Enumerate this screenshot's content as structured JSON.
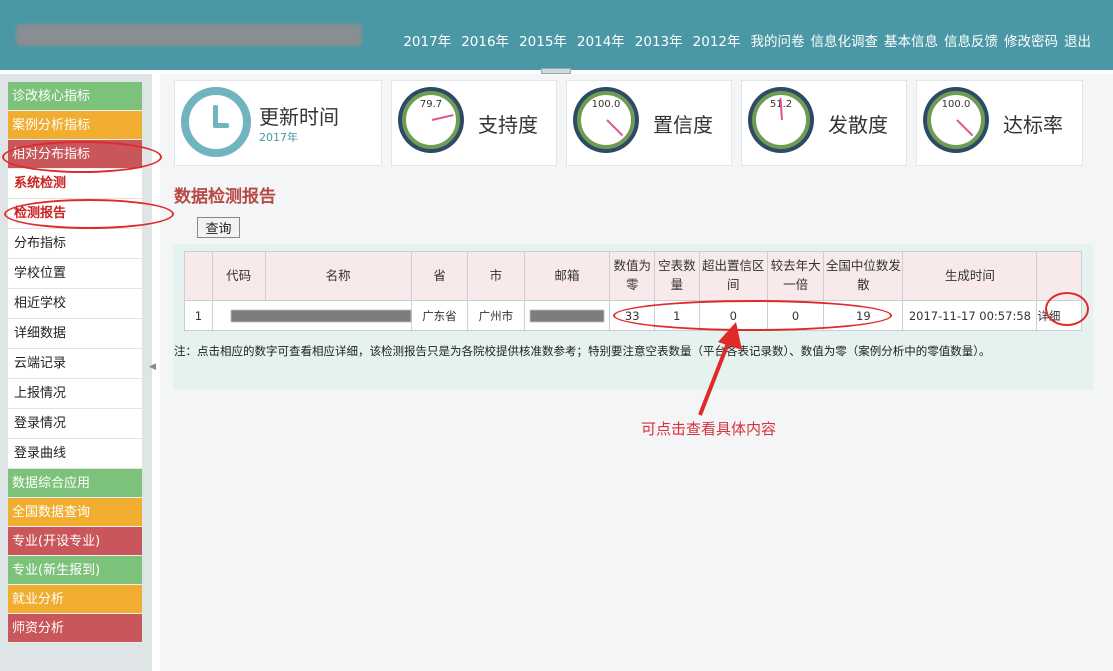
{
  "header": {
    "nav": [
      "2017年",
      "2016年",
      "2015年",
      "2014年",
      "2013年",
      "2012年",
      "我的问卷",
      "信息化调查",
      "基本信息",
      "信息反馈",
      "修改密码",
      "退出"
    ]
  },
  "sidebar": {
    "items": [
      {
        "label": "诊改核心指标",
        "style": "green"
      },
      {
        "label": "案例分析指标",
        "style": "orange"
      },
      {
        "label": "相对分布指标",
        "style": "red"
      },
      {
        "label": "系统检测",
        "style": "sub-hl"
      },
      {
        "label": "检测报告",
        "style": "sub-hl"
      },
      {
        "label": "分布指标",
        "style": "sub"
      },
      {
        "label": "学校位置",
        "style": "sub"
      },
      {
        "label": "相近学校",
        "style": "sub"
      },
      {
        "label": "详细数据",
        "style": "sub"
      },
      {
        "label": "云端记录",
        "style": "sub"
      },
      {
        "label": "上报情况",
        "style": "sub"
      },
      {
        "label": "登录情况",
        "style": "sub"
      },
      {
        "label": "登录曲线",
        "style": "sub"
      },
      {
        "label": "数据综合应用",
        "style": "green"
      },
      {
        "label": "全国数据查询",
        "style": "orange"
      },
      {
        "label": "专业(开设专业)",
        "style": "red"
      },
      {
        "label": "专业(新生报到)",
        "style": "green"
      },
      {
        "label": "就业分析",
        "style": "orange"
      },
      {
        "label": "师资分析",
        "style": "red"
      }
    ]
  },
  "cards": {
    "update": {
      "title": "更新时间",
      "sub": "2017年"
    },
    "support": {
      "title": "支持度",
      "value": "79.7"
    },
    "confidence": {
      "title": "置信度",
      "value": "100.0"
    },
    "dispersion": {
      "title": "发散度",
      "value": "51.2"
    },
    "compliance": {
      "title": "达标率",
      "value": "100.0"
    }
  },
  "report": {
    "title": "数据检测报告",
    "query_label": "查询",
    "headers": [
      "",
      "代码",
      "名称",
      "省",
      "市",
      "邮箱",
      "数值为零",
      "空表数量",
      "超出置信区间",
      "较去年大一倍",
      "全国中位数发散",
      "生成时间",
      ""
    ],
    "row": {
      "index": "1",
      "province": "广东省",
      "city": "广州市",
      "zero": "33",
      "empty": "1",
      "out_ci": "0",
      "double": "0",
      "median_div": "19",
      "time": "2017-11-17 00:57:58",
      "detail": "详细"
    },
    "note": "注：点击相应的数字可查看相应详细，该检测报告只是为各院校提供核准数参考；特别要注意空表数量（平台各表记录数）、数值为零（案例分析中的零值数量）。"
  },
  "annotation": {
    "text": "可点击查看具体内容",
    "color": "#e02a2a"
  }
}
